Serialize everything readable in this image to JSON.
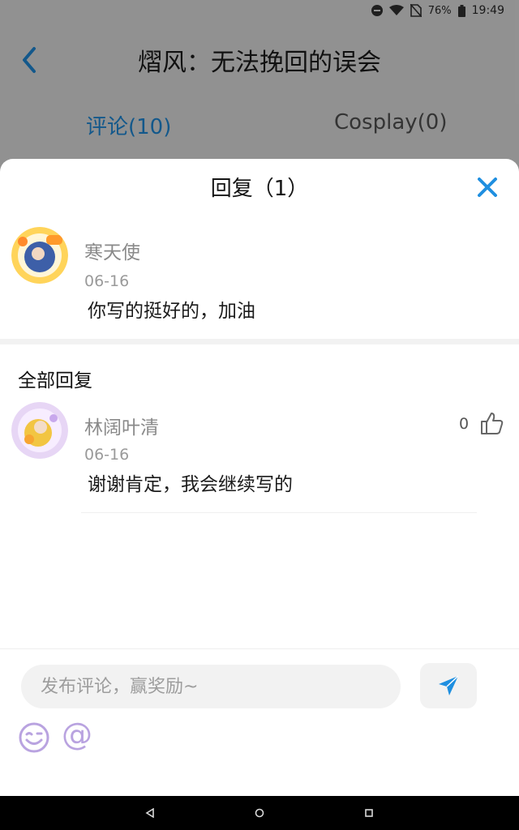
{
  "status_bar": {
    "battery": "76%",
    "time": "19:49"
  },
  "app_bar": {
    "title": "熠风：无法挽回的误会"
  },
  "tabs": [
    {
      "label": "评论(10)",
      "active": true
    },
    {
      "label": "Cosplay(0)",
      "active": false
    }
  ],
  "sheet": {
    "title": "回复（1）",
    "close_icon": "close-icon",
    "original": {
      "name": "寒天使",
      "date": "06-16",
      "text": "你写的挺好的，加油"
    },
    "section_title": "全部回复",
    "replies": [
      {
        "name": "林阔叶清",
        "date": "06-16",
        "text": "谢谢肯定，我会继续写的",
        "likes": "0"
      }
    ],
    "composer": {
      "placeholder": "发布评论，赢奖励~",
      "at_label": "@"
    }
  },
  "colors": {
    "accent": "#1f8fe0",
    "dim": "#5f5f5f",
    "purple": "#b9a3e0"
  }
}
